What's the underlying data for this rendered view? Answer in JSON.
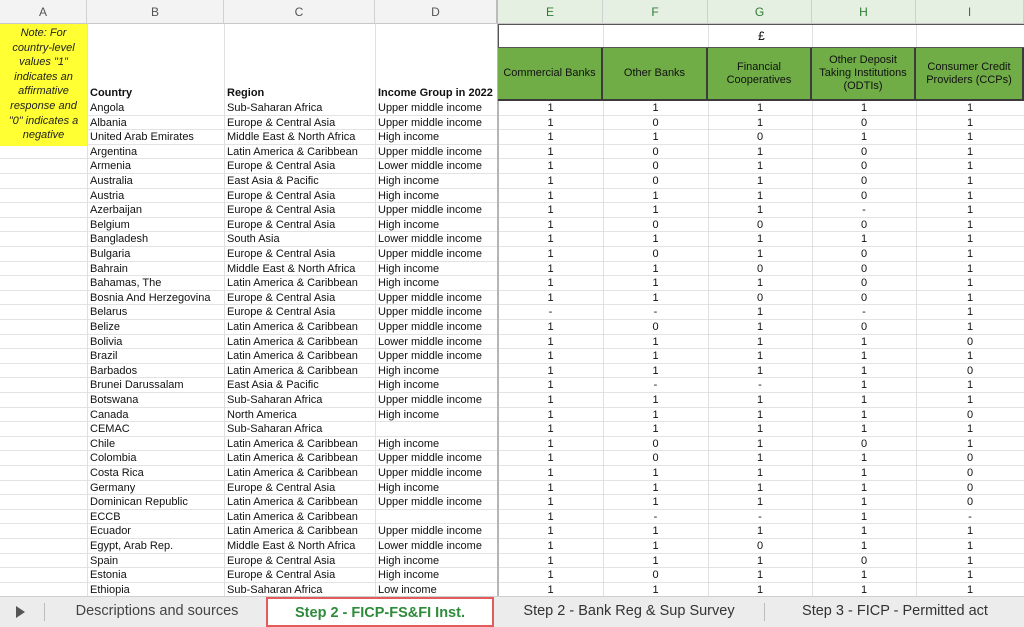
{
  "column_headers": [
    "A",
    "B",
    "C",
    "D",
    "E",
    "F",
    "G",
    "H",
    "I"
  ],
  "note": "Note: For country-level values \"1\" indicates an affirmative response and \"0\" indicates a negative response",
  "headers": {
    "country": "Country",
    "region": "Region",
    "income": "Income Group in 2022",
    "currency": "£",
    "e": "Commercial Banks",
    "f": "Other Banks",
    "g": "Financial Cooperatives",
    "h": "Other Deposit Taking Institutions (ODTIs)",
    "i": "Consumer Credit Providers (CCPs)"
  },
  "rows": [
    [
      "Angola",
      "Sub-Saharan Africa",
      "Upper middle income",
      "1",
      "1",
      "1",
      "1",
      "1"
    ],
    [
      "Albania",
      "Europe & Central Asia",
      "Upper middle income",
      "1",
      "0",
      "1",
      "0",
      "1"
    ],
    [
      "United Arab Emirates",
      "Middle East & North Africa",
      "High income",
      "1",
      "1",
      "0",
      "1",
      "1"
    ],
    [
      "Argentina",
      "Latin America & Caribbean",
      "Upper middle income",
      "1",
      "0",
      "1",
      "0",
      "1"
    ],
    [
      "Armenia",
      "Europe & Central Asia",
      "Lower middle income",
      "1",
      "0",
      "1",
      "0",
      "1"
    ],
    [
      "Australia",
      "East Asia & Pacific",
      "High income",
      "1",
      "0",
      "1",
      "0",
      "1"
    ],
    [
      "Austria",
      "Europe & Central Asia",
      "High income",
      "1",
      "1",
      "1",
      "0",
      "1"
    ],
    [
      "Azerbaijan",
      "Europe & Central Asia",
      "Upper middle income",
      "1",
      "1",
      "1",
      "-",
      "1"
    ],
    [
      "Belgium",
      "Europe & Central Asia",
      "High income",
      "1",
      "0",
      "0",
      "0",
      "1"
    ],
    [
      "Bangladesh",
      "South Asia",
      "Lower middle income",
      "1",
      "1",
      "1",
      "1",
      "1"
    ],
    [
      "Bulgaria",
      "Europe & Central Asia",
      "Upper middle income",
      "1",
      "0",
      "1",
      "0",
      "1"
    ],
    [
      "Bahrain",
      "Middle East & North Africa",
      "High income",
      "1",
      "1",
      "0",
      "0",
      "1"
    ],
    [
      "Bahamas, The",
      "Latin America & Caribbean",
      "High income",
      "1",
      "1",
      "1",
      "0",
      "1"
    ],
    [
      "Bosnia And Herzegovina",
      "Europe & Central Asia",
      "Upper middle income",
      "1",
      "1",
      "0",
      "0",
      "1"
    ],
    [
      "Belarus",
      "Europe & Central Asia",
      "Upper middle income",
      "-",
      "-",
      "1",
      "-",
      "1"
    ],
    [
      "Belize",
      "Latin America & Caribbean",
      "Upper middle income",
      "1",
      "0",
      "1",
      "0",
      "1"
    ],
    [
      "Bolivia",
      "Latin America & Caribbean",
      "Lower middle income",
      "1",
      "1",
      "1",
      "1",
      "0"
    ],
    [
      "Brazil",
      "Latin America & Caribbean",
      "Upper middle income",
      "1",
      "1",
      "1",
      "1",
      "1"
    ],
    [
      "Barbados",
      "Latin America & Caribbean",
      "High income",
      "1",
      "1",
      "1",
      "1",
      "0"
    ],
    [
      "Brunei Darussalam",
      "East Asia & Pacific",
      "High income",
      "1",
      "-",
      "-",
      "1",
      "1"
    ],
    [
      "Botswana",
      "Sub-Saharan Africa",
      "Upper middle income",
      "1",
      "1",
      "1",
      "1",
      "1"
    ],
    [
      "Canada",
      "North America",
      "High income",
      "1",
      "1",
      "1",
      "1",
      "0"
    ],
    [
      "CEMAC",
      "Sub-Saharan Africa",
      "",
      "1",
      "1",
      "1",
      "1",
      "1"
    ],
    [
      "Chile",
      "Latin America & Caribbean",
      "High income",
      "1",
      "0",
      "1",
      "0",
      "1"
    ],
    [
      "Colombia",
      "Latin America & Caribbean",
      "Upper middle income",
      "1",
      "0",
      "1",
      "1",
      "0"
    ],
    [
      "Costa Rica",
      "Latin America & Caribbean",
      "Upper middle income",
      "1",
      "1",
      "1",
      "1",
      "0"
    ],
    [
      "Germany",
      "Europe & Central Asia",
      "High income",
      "1",
      "1",
      "1",
      "1",
      "0"
    ],
    [
      "Dominican Republic",
      "Latin America & Caribbean",
      "Upper middle income",
      "1",
      "1",
      "1",
      "1",
      "0"
    ],
    [
      "ECCB",
      "Latin America & Caribbean",
      "",
      "1",
      "-",
      "-",
      "1",
      "-"
    ],
    [
      "Ecuador",
      "Latin America & Caribbean",
      "Upper middle income",
      "1",
      "1",
      "1",
      "1",
      "1"
    ],
    [
      "Egypt, Arab Rep.",
      "Middle East & North Africa",
      "Lower middle income",
      "1",
      "1",
      "0",
      "1",
      "1"
    ],
    [
      "Spain",
      "Europe & Central Asia",
      "High income",
      "1",
      "1",
      "1",
      "0",
      "1"
    ],
    [
      "Estonia",
      "Europe & Central Asia",
      "High income",
      "1",
      "0",
      "1",
      "1",
      "1"
    ],
    [
      "Ethiopia",
      "Sub-Saharan Africa",
      "Low income",
      "1",
      "1",
      "1",
      "1",
      "1"
    ]
  ],
  "tabs": [
    "Descriptions and sources",
    "Step 2 - FICP-FS&FI Inst.",
    "Step 2 - Bank Reg & Sup Survey",
    "Step 3 - FICP - Permitted act"
  ],
  "colors": {
    "green_header": "#70ad47",
    "note_fill": "#ffff33",
    "active_tab_text": "#2e8b3a",
    "active_tab_border": "#e25c5c"
  }
}
